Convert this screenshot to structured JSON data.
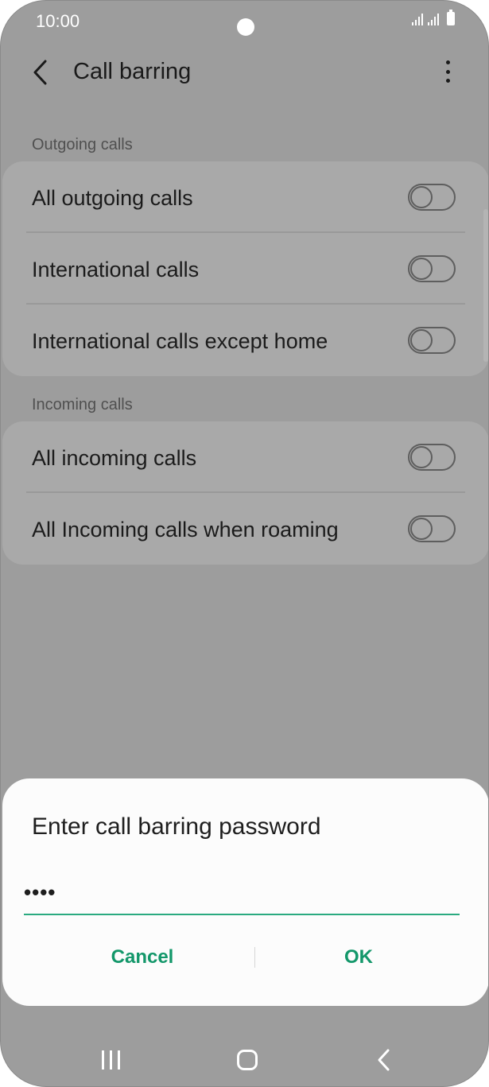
{
  "status_bar": {
    "time": "10:00"
  },
  "app_bar": {
    "title": "Call barring",
    "back_icon": "arrow-back-icon",
    "more_icon": "more-vertical-icon"
  },
  "sections": [
    {
      "header": "Outgoing calls",
      "items": [
        {
          "label": "All outgoing calls",
          "enabled": false
        },
        {
          "label": "International calls",
          "enabled": false
        },
        {
          "label": "International calls except home",
          "enabled": false
        }
      ]
    },
    {
      "header": "Incoming calls",
      "items": [
        {
          "label": "All incoming calls",
          "enabled": false
        },
        {
          "label": "All Incoming calls when roaming",
          "enabled": false
        }
      ]
    }
  ],
  "dialog": {
    "title": "Enter call barring password",
    "password_value": "••••",
    "cancel_label": "Cancel",
    "ok_label": "OK",
    "accent_color": "#13976a"
  },
  "nav_bar": {
    "recents_icon": "recents-icon",
    "home_icon": "home-icon",
    "back_icon": "back-icon"
  }
}
